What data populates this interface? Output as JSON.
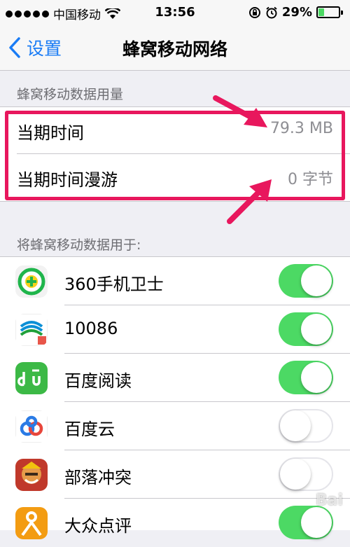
{
  "status_bar": {
    "carrier": "中国移动",
    "time": "13:56",
    "battery": "29%",
    "battery_level": 0.29
  },
  "nav": {
    "back_label": "设置",
    "title": "蜂窝移动网络"
  },
  "usage": {
    "header": "蜂窝移动数据用量",
    "rows": [
      {
        "label": "当期时间",
        "value": "79.3 MB"
      },
      {
        "label": "当期时间漫游",
        "value": "0 字节"
      }
    ]
  },
  "apps": {
    "header": "将蜂窝移动数据用于:",
    "items": [
      {
        "name": "360手机卫士",
        "icon": "360-security-icon",
        "enabled": true
      },
      {
        "name": "10086",
        "icon": "china-mobile-icon",
        "enabled": true
      },
      {
        "name": "百度阅读",
        "icon": "baidu-read-icon",
        "enabled": true
      },
      {
        "name": "百度云",
        "icon": "baidu-cloud-icon",
        "enabled": false
      },
      {
        "name": "部落冲突",
        "icon": "clash-of-clans-icon",
        "enabled": false
      },
      {
        "name": "大众点评",
        "icon": "dianping-icon",
        "enabled": true
      }
    ]
  },
  "watermark": "Bai"
}
